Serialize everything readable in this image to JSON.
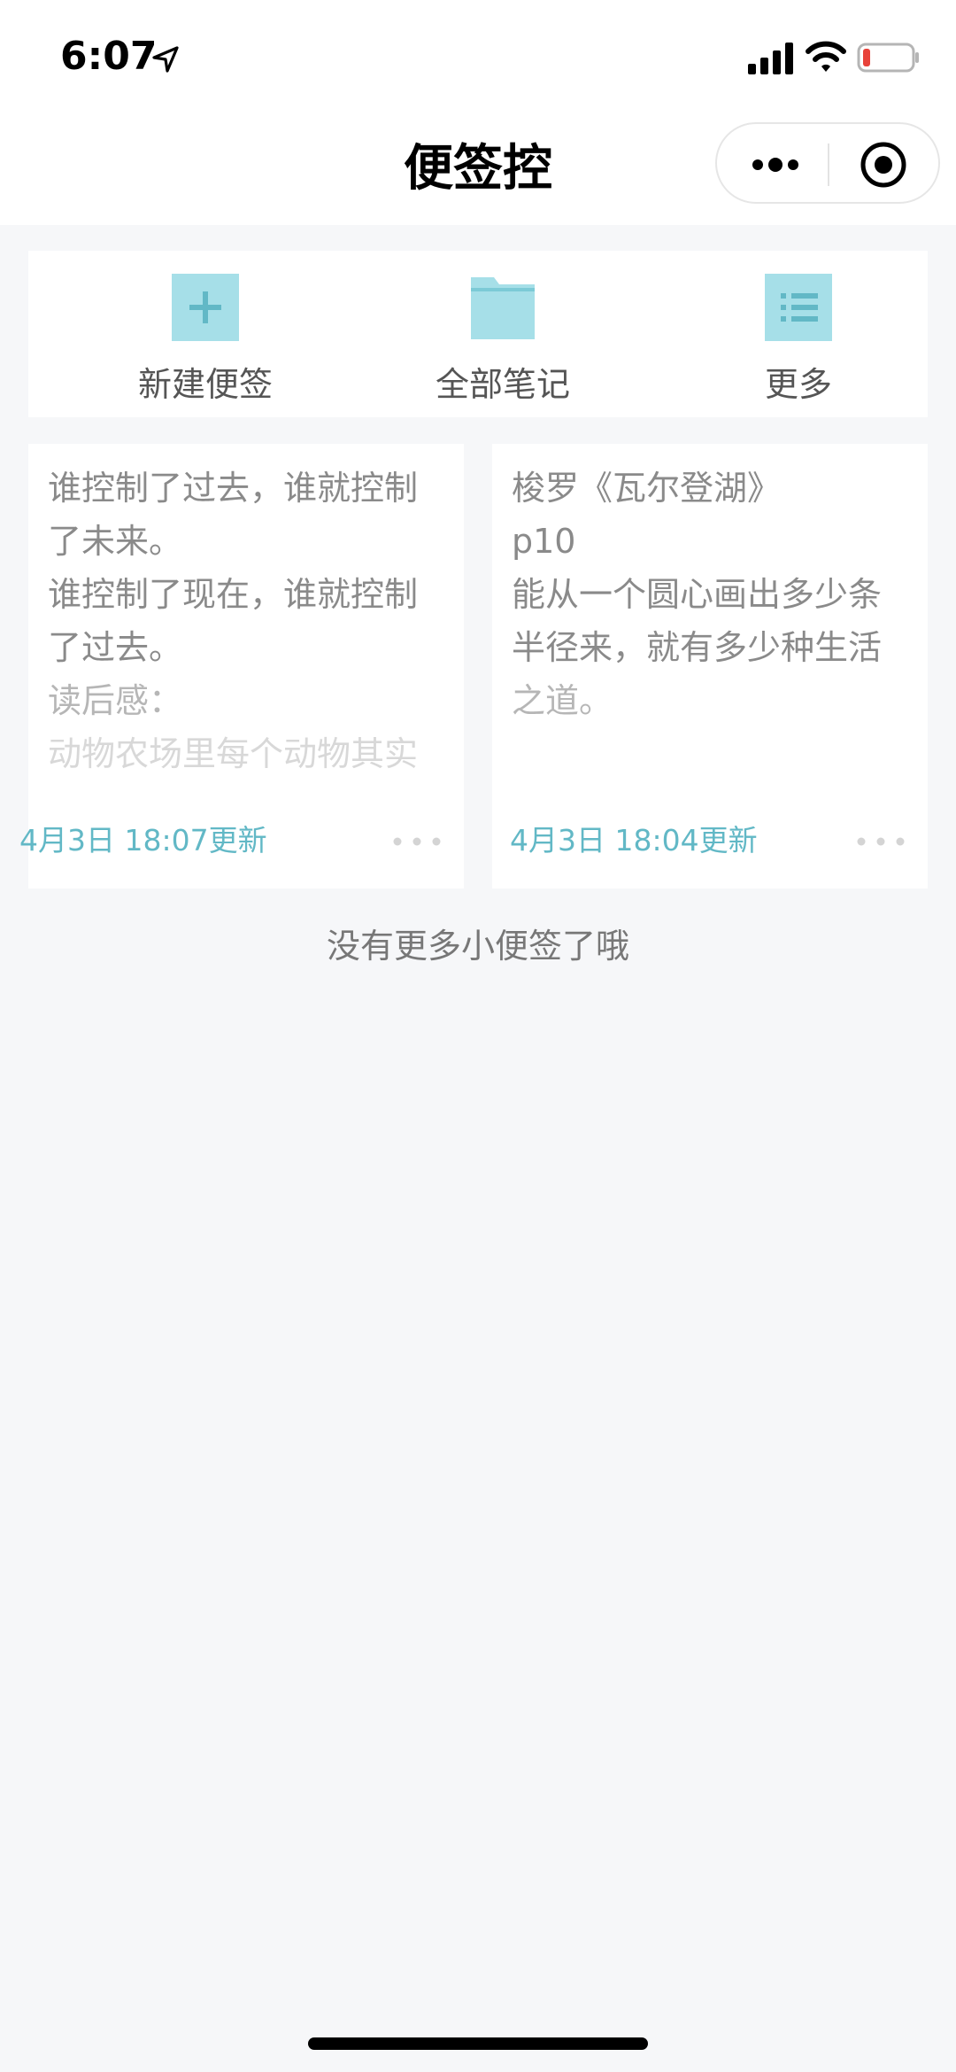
{
  "status_bar": {
    "time": "6:07",
    "icons": [
      "location-arrow-icon",
      "cellular-signal-icon",
      "wifi-icon",
      "battery-low-icon"
    ]
  },
  "nav": {
    "title": "便签控",
    "capsule_icons": [
      "more-dots-icon",
      "close-target-icon"
    ]
  },
  "toolbar": {
    "items": [
      {
        "label": "新建便签",
        "icon": "plus-icon"
      },
      {
        "label": "全部笔记",
        "icon": "folder-icon"
      },
      {
        "label": "更多",
        "icon": "list-icon"
      }
    ]
  },
  "notes": [
    {
      "lines": [
        "谁控制了过去，谁就控制",
        "了未来。",
        "谁控制了现在，谁就控制",
        "了过去。",
        "读后感：",
        "动物农场里每个动物其实"
      ],
      "updated": "4月3日 18:07更新"
    },
    {
      "lines": [
        "梭罗《瓦尔登湖》",
        "p10",
        "能从一个圆心画出多少条",
        "半径来，就有多少种生活",
        "之道。"
      ],
      "updated": "4月3日 18:04更新"
    }
  ],
  "footer": {
    "end_message": "没有更多小便签了哦"
  },
  "colors": {
    "accent": "#62b8c6",
    "icon_fill": "#a6dfe8",
    "background": "#f6f7f9"
  }
}
